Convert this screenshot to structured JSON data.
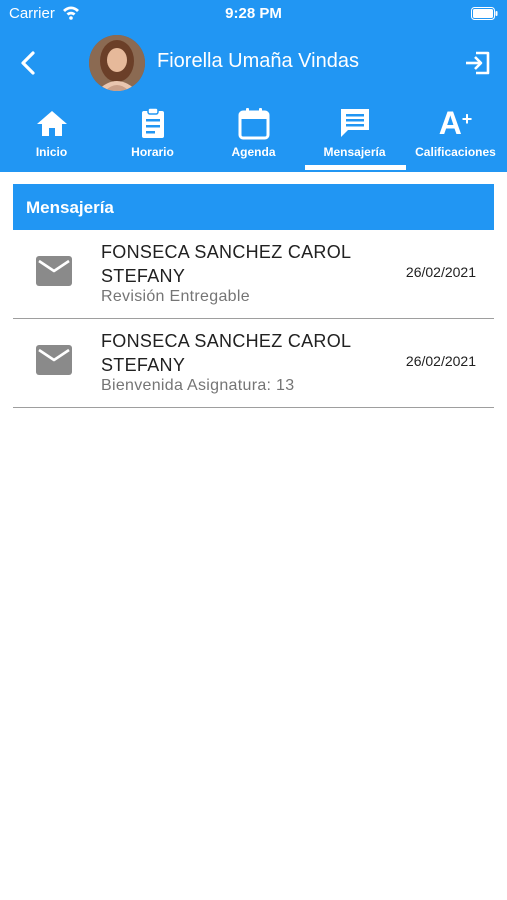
{
  "status_bar": {
    "carrier": "Carrier",
    "time": "9:28 PM"
  },
  "header": {
    "user_name": "Fiorella Umaña Vindas",
    "back_icon": "chevron-left-icon",
    "logout_icon": "logout-icon"
  },
  "tabs": [
    {
      "label": "Inicio",
      "icon": "home-icon"
    },
    {
      "label": "Horario",
      "icon": "clipboard-icon"
    },
    {
      "label": "Agenda",
      "icon": "calendar-icon"
    },
    {
      "label": "Mensajería",
      "icon": "message-icon",
      "active": true
    },
    {
      "label": "Calificaciones",
      "icon": "grade-icon",
      "glyph": "A",
      "glyph_sup": "+"
    }
  ],
  "section": {
    "title": "Mensajería"
  },
  "messages": [
    {
      "sender": "FONSECA SANCHEZ CAROL STEFANY",
      "subject": "Revisión Entregable",
      "date": "26/02/2021",
      "icon": "mail-icon"
    },
    {
      "sender": "FONSECA SANCHEZ CAROL STEFANY",
      "subject": "Bienvenida Asignatura: 13",
      "date": "26/02/2021",
      "icon": "mail-icon"
    }
  ],
  "colors": {
    "primary": "#2196f3",
    "mail_icon": "#8a8a8a",
    "divider": "#9e9e9e",
    "subject_text": "#757575"
  }
}
